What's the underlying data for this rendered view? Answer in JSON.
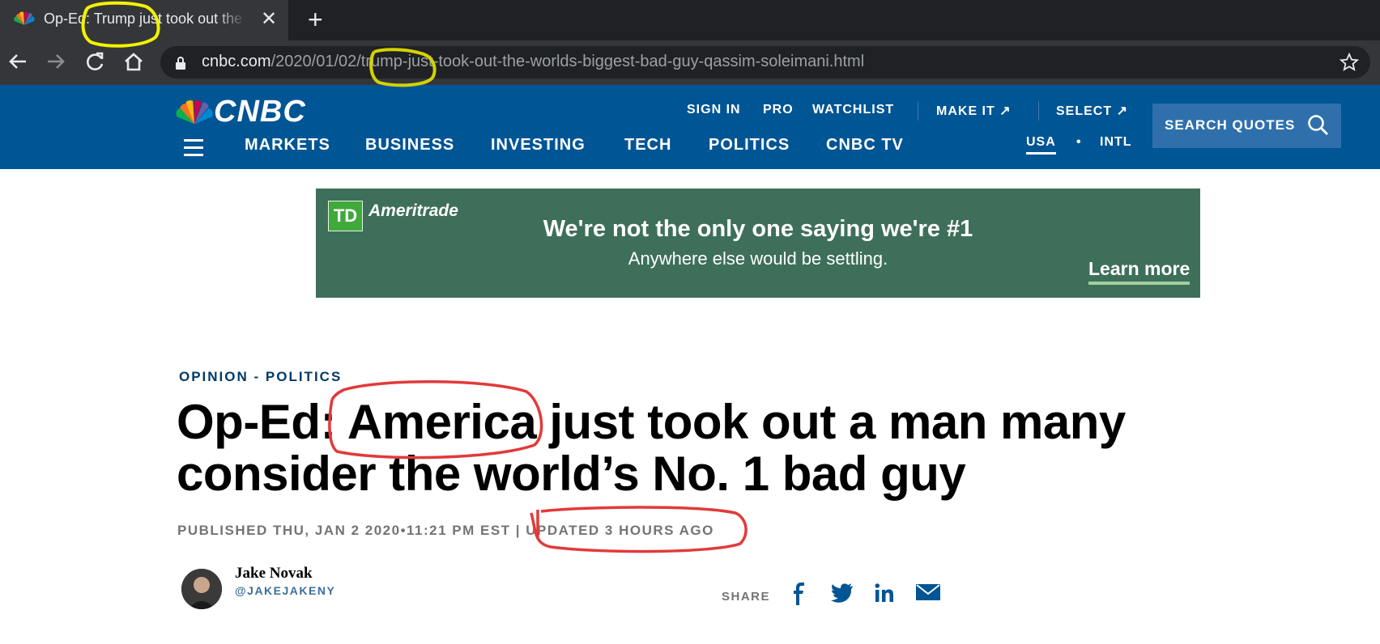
{
  "browser": {
    "tab_title": "Op-Ed: Trump just took out the world's biggest bad guy",
    "close_glyph": "✕",
    "new_tab_glyph": "+",
    "url_host": "cnbc.com",
    "url_path": "/2020/01/02/trump-just-took-out-the-worlds-biggest-bad-guy-qassim-soleimani.html"
  },
  "header": {
    "logo": "CNBC",
    "top_links": [
      "SIGN IN",
      "PRO",
      "WATCHLIST",
      "MAKE IT",
      "SELECT"
    ],
    "external_arrow": "↗",
    "nav": [
      "MARKETS",
      "BUSINESS",
      "INVESTING",
      "TECH",
      "POLITICS",
      "CNBC TV"
    ],
    "region_usa": "USA",
    "region_dot": "•",
    "region_intl": "INTL",
    "search_label": "SEARCH QUOTES"
  },
  "ad": {
    "logo_mark": "TD",
    "brand": "Ameritrade",
    "headline": "We're not the only one saying we're #1",
    "subline": "Anywhere else would be settling.",
    "cta": "Learn more"
  },
  "article": {
    "kicker": "OPINION - POLITICS",
    "headline": "Op-Ed: America just took out a man many consider the world’s No. 1 bad guy",
    "published": "PUBLISHED THU, JAN 2 2020•11:21 PM EST | UPDATED 3 HOURS AGO",
    "author": "Jake Novak",
    "handle": "@JAKEJAKENY",
    "share_label": "SHARE"
  },
  "colors": {
    "cnbc_blue": "#005594",
    "ad_green": "#3e6f5a",
    "annotation_yellow": "#f2f200",
    "annotation_red": "#e23a3a"
  },
  "icons": [
    "nbc-peacock-icon",
    "back-arrow-icon",
    "forward-arrow-icon",
    "reload-icon",
    "home-icon",
    "lock-icon",
    "star-icon",
    "hamburger-icon",
    "search-icon",
    "facebook-icon",
    "twitter-icon",
    "linkedin-icon",
    "email-icon"
  ]
}
